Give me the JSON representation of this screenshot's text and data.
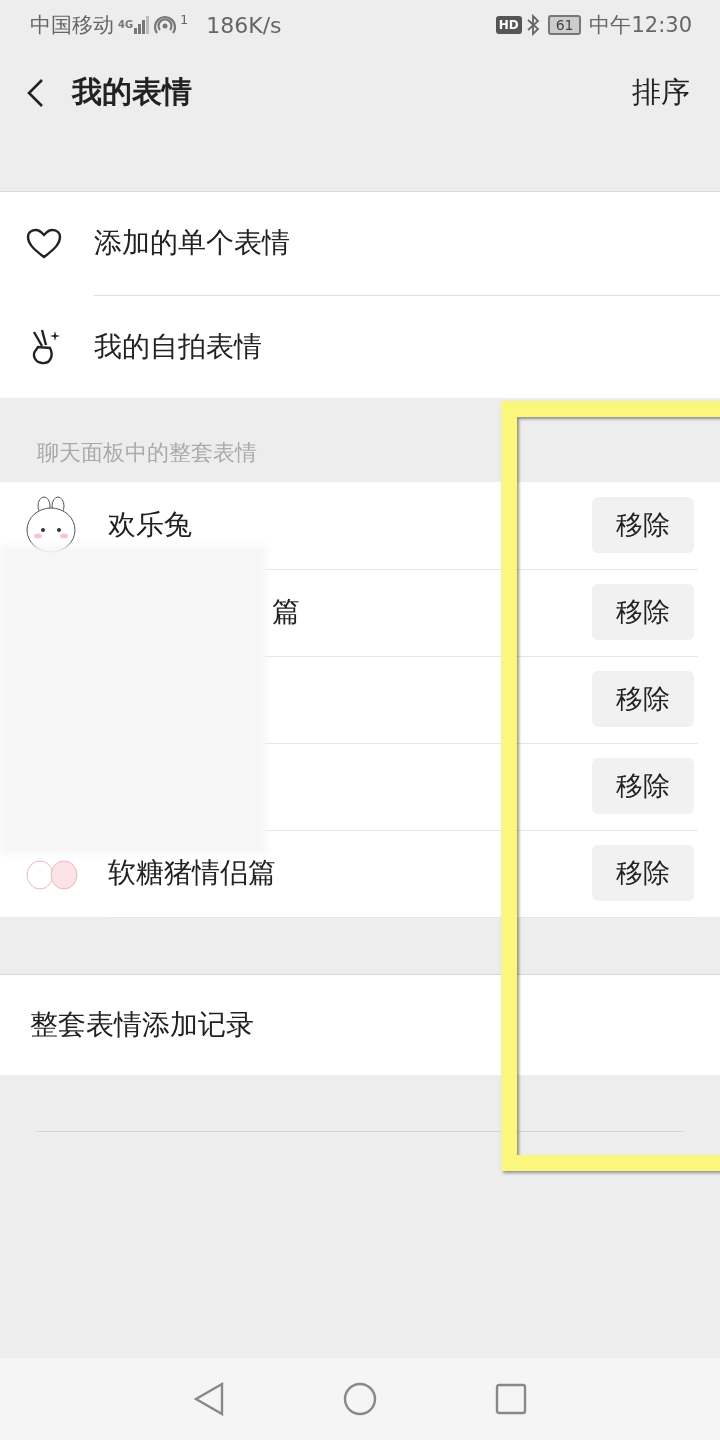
{
  "status_bar": {
    "carrier": "中国移动",
    "network": "4G",
    "hotspot_count": "1",
    "speed": "186K/s",
    "hd": "HD",
    "battery": "61",
    "time": "中午12:30"
  },
  "nav": {
    "title": "我的表情",
    "action": "排序"
  },
  "personal_items": [
    {
      "kind": "heart",
      "label": "添加的单个表情"
    },
    {
      "kind": "selfie",
      "label": "我的自拍表情"
    }
  ],
  "section_header": "聊天面板中的整套表情",
  "sticker_sets": [
    {
      "kind": "bunny",
      "title": "欢乐兔",
      "button": "移除"
    },
    {
      "kind": "partial",
      "title": "篇",
      "button": "移除"
    },
    {
      "kind": "hidden",
      "button": "移除"
    },
    {
      "kind": "hidden",
      "button": "移除"
    },
    {
      "kind": "pig",
      "title": "软糖猪情侣篇",
      "button": "移除"
    }
  ],
  "record_item": "整套表情添加记录"
}
